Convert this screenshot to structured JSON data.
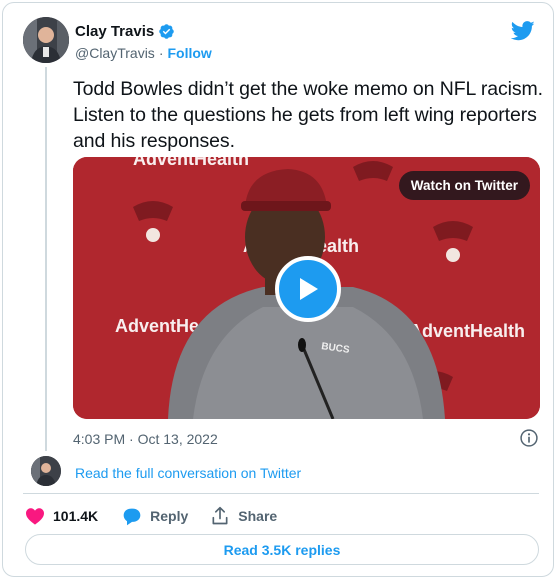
{
  "author": {
    "display_name": "Clay Travis",
    "handle": "@ClayTravis",
    "separator": "·",
    "follow_label": "Follow",
    "verified": true
  },
  "tweet": {
    "text": "Todd Bowles didn’t get the woke memo on NFL racism. Listen to the questions he gets from left wing reporters and his responses.",
    "timestamp": "4:03 PM · Oct 13, 2022"
  },
  "media": {
    "watch_label": "Watch on Twitter",
    "backdrop_sponsor": "AdventHealth"
  },
  "conversation": {
    "link_label": "Read the full conversation on Twitter"
  },
  "actions": {
    "like_count": "101.4K",
    "reply_label": "Reply",
    "share_label": "Share"
  },
  "replies": {
    "button_label": "Read 3.5K replies"
  },
  "colors": {
    "accent": "#1d9bf0",
    "like": "#f91880",
    "muted": "#536471",
    "border": "#cfd9de",
    "backdrop_red": "#b0272e"
  }
}
